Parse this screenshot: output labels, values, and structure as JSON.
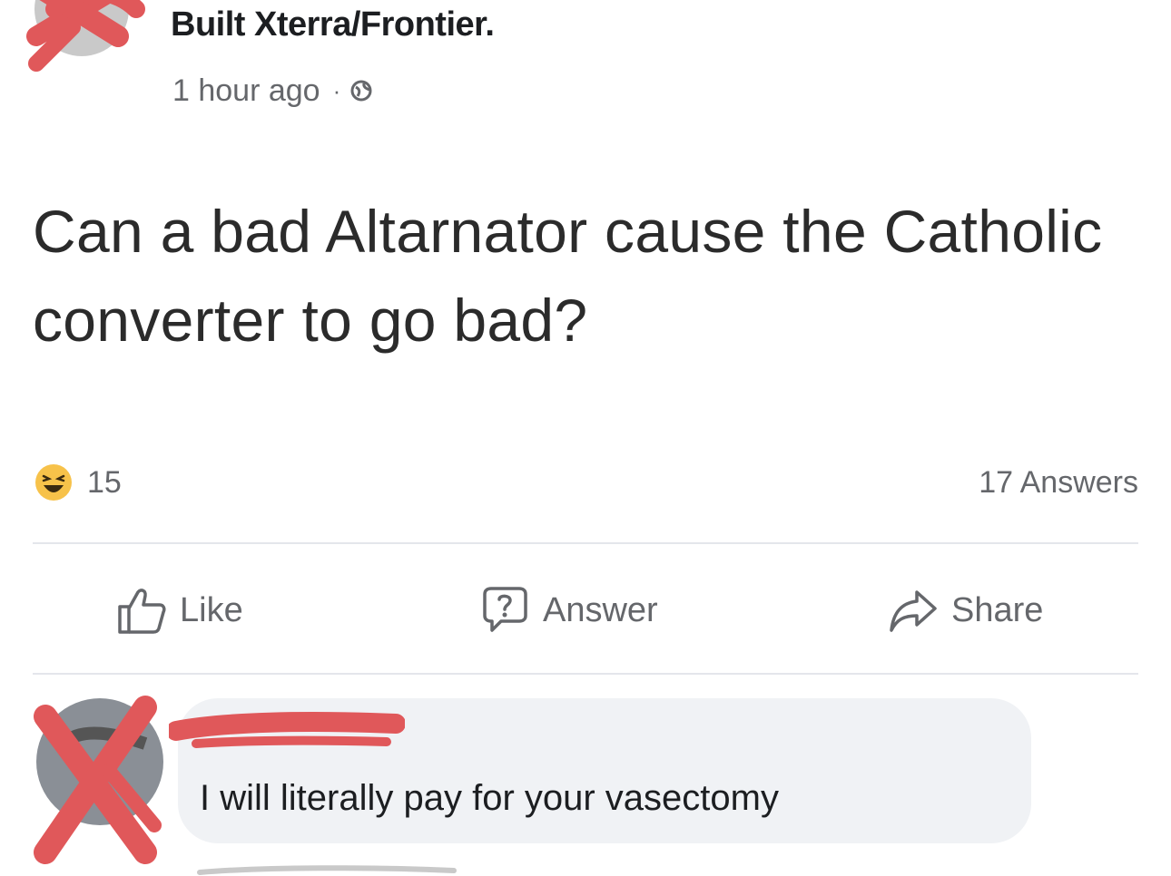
{
  "post": {
    "group_name": "Built Xterra/Frontier.",
    "timestamp": "1 hour ago",
    "separator": "·",
    "privacy_icon": "globe-icon",
    "question": "Can a bad Altarnator cause the Catholic converter to go bad?"
  },
  "stats": {
    "reaction_icon": "haha-reaction-icon",
    "reaction_count": "15",
    "answers_count": "17 Answers"
  },
  "actions": {
    "like_label": "Like",
    "like_icon": "thumbs-up-icon",
    "answer_label": "Answer",
    "answer_icon": "question-bubble-icon",
    "share_label": "Share",
    "share_icon": "share-arrow-icon"
  },
  "comment": {
    "text": "I will literally pay for your vasectomy"
  },
  "colors": {
    "redaction": "#e0585a",
    "secondary_text": "#65676b",
    "bubble": "#f0f2f5",
    "haha_yellow": "#f7c24a"
  }
}
